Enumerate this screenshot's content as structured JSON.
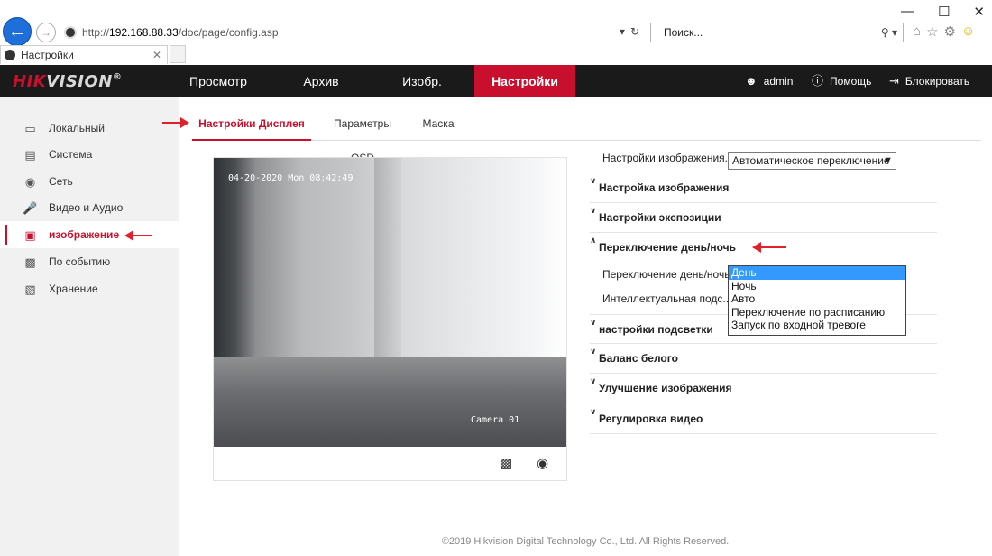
{
  "browser": {
    "url_prefix": "http://",
    "url_host": "192.168.88.33",
    "url_path": "/doc/page/config.asp",
    "search_placeholder": "Поиск...",
    "tab_title": "Настройки",
    "window_controls": [
      "—",
      "☐",
      "✕"
    ]
  },
  "app": {
    "brand_a": "HIK",
    "brand_b": "VISION",
    "brand_mark": "®",
    "nav": [
      "Просмотр",
      "Архив",
      "Изобр.",
      "Настройки"
    ],
    "user": "admin",
    "help": "Помощь",
    "lock": "Блокировать",
    "accent_color": "#c8102e"
  },
  "sidebar": {
    "items": [
      {
        "label": "Локальный",
        "icon": "monitor-icon"
      },
      {
        "label": "Система",
        "icon": "system-icon"
      },
      {
        "label": "Сеть",
        "icon": "globe-icon"
      },
      {
        "label": "Видео и Аудио",
        "icon": "microphone-icon"
      },
      {
        "label": "изображение",
        "icon": "image-icon",
        "active": true
      },
      {
        "label": "По событию",
        "icon": "calendar-icon"
      },
      {
        "label": "Хранение",
        "icon": "storage-icon"
      }
    ]
  },
  "tabs": [
    "Настройки Дисплея",
    "Параметры OSD",
    "Маска"
  ],
  "video": {
    "osd_time": "04-20-2020 Mon 08:42:49",
    "osd_camera": "Camera 01"
  },
  "settings": {
    "image_settings_label": "Настройки изображения...",
    "image_settings_value": "Автоматическое переключение",
    "sections": [
      "Настройка изображения",
      "Настройки экспозиции",
      "Переключение день/ночь",
      "настройки подсветки",
      "Баланс белого",
      "Улучшение изображения",
      "Регулировка видео"
    ],
    "daynight_label": "Переключение день/ночь",
    "intelligent_label": "Интеллектуальная подс...",
    "daynight_options": [
      "День",
      "Ночь",
      "Авто",
      "Переключение по расписанию",
      "Запуск по входной тревоге"
    ],
    "daynight_selected": "День"
  },
  "footer": "©2019 Hikvision Digital Technology Co., Ltd. All Rights Reserved."
}
